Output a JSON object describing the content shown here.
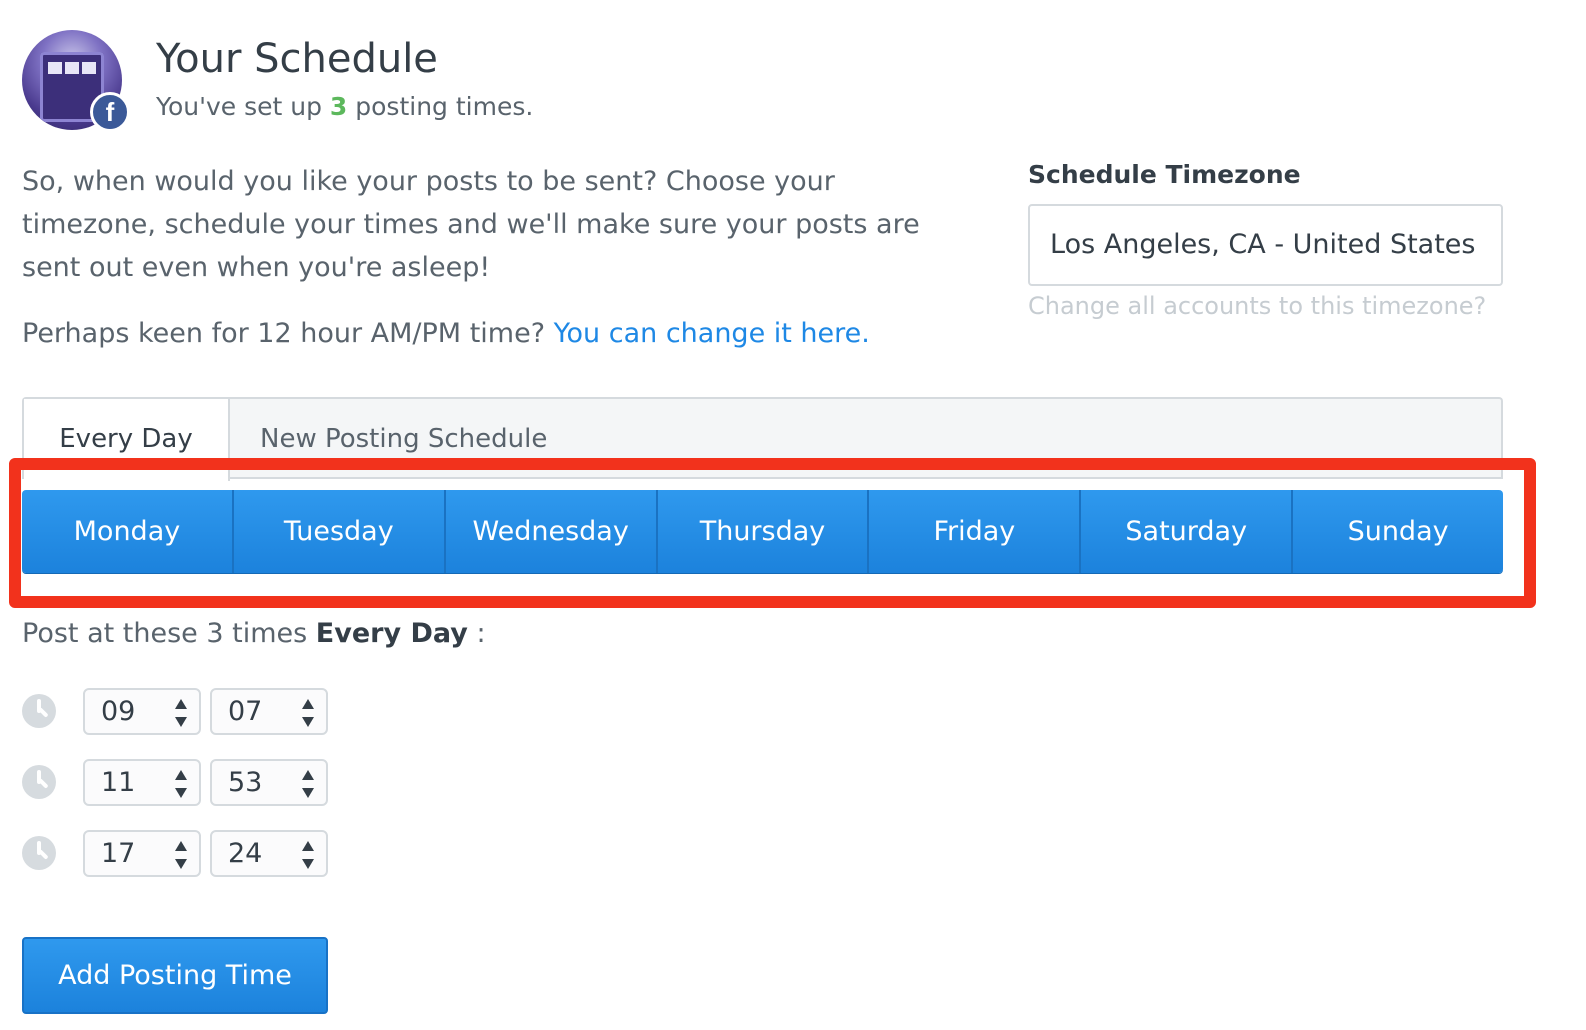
{
  "header": {
    "title": "Your Schedule",
    "subtitle_prefix": "You've set up ",
    "subtitle_count": "3",
    "subtitle_suffix": " posting times.",
    "badge_icon": "facebook-icon",
    "badge_letter": "f"
  },
  "intro": {
    "text": "So, when would you like your posts to be sent? Choose your timezone, schedule your times and we'll make sure your posts are sent out even when you're asleep!",
    "ampm_prefix": "Perhaps keen for 12 hour AM/PM time? ",
    "ampm_link": "You can change it here."
  },
  "timezone": {
    "label": "Schedule Timezone",
    "value": "Los Angeles, CA - United States",
    "change_link": "Change all accounts to this timezone?"
  },
  "tabs": [
    {
      "label": "Every Day",
      "active": true
    },
    {
      "label": "New Posting Schedule",
      "active": false
    }
  ],
  "days": [
    "Monday",
    "Tuesday",
    "Wednesday",
    "Thursday",
    "Friday",
    "Saturday",
    "Sunday"
  ],
  "post_at": {
    "prefix": "Post at these 3 times ",
    "bold": "Every Day",
    "suffix": " :"
  },
  "times": [
    {
      "hour": "09",
      "minute": "07"
    },
    {
      "hour": "11",
      "minute": "53"
    },
    {
      "hour": "17",
      "minute": "24"
    }
  ],
  "add_button": "Add Posting Time",
  "colors": {
    "accent": "#1e88e5",
    "highlight": "#f2321c",
    "count_green": "#5cb85c"
  }
}
